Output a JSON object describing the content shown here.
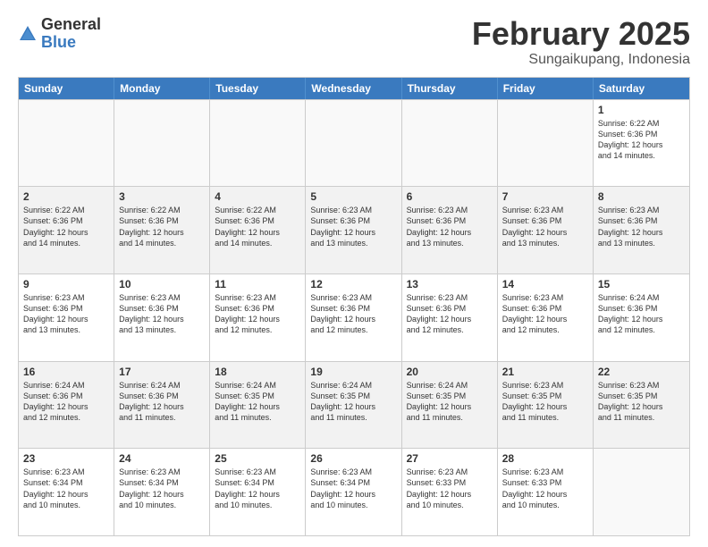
{
  "logo": {
    "general": "General",
    "blue": "Blue"
  },
  "title": "February 2025",
  "location": "Sungaikupang, Indonesia",
  "days_of_week": [
    "Sunday",
    "Monday",
    "Tuesday",
    "Wednesday",
    "Thursday",
    "Friday",
    "Saturday"
  ],
  "weeks": [
    [
      {
        "num": "",
        "info": ""
      },
      {
        "num": "",
        "info": ""
      },
      {
        "num": "",
        "info": ""
      },
      {
        "num": "",
        "info": ""
      },
      {
        "num": "",
        "info": ""
      },
      {
        "num": "",
        "info": ""
      },
      {
        "num": "1",
        "info": "Sunrise: 6:22 AM\nSunset: 6:36 PM\nDaylight: 12 hours\nand 14 minutes."
      }
    ],
    [
      {
        "num": "2",
        "info": "Sunrise: 6:22 AM\nSunset: 6:36 PM\nDaylight: 12 hours\nand 14 minutes."
      },
      {
        "num": "3",
        "info": "Sunrise: 6:22 AM\nSunset: 6:36 PM\nDaylight: 12 hours\nand 14 minutes."
      },
      {
        "num": "4",
        "info": "Sunrise: 6:22 AM\nSunset: 6:36 PM\nDaylight: 12 hours\nand 14 minutes."
      },
      {
        "num": "5",
        "info": "Sunrise: 6:23 AM\nSunset: 6:36 PM\nDaylight: 12 hours\nand 13 minutes."
      },
      {
        "num": "6",
        "info": "Sunrise: 6:23 AM\nSunset: 6:36 PM\nDaylight: 12 hours\nand 13 minutes."
      },
      {
        "num": "7",
        "info": "Sunrise: 6:23 AM\nSunset: 6:36 PM\nDaylight: 12 hours\nand 13 minutes."
      },
      {
        "num": "8",
        "info": "Sunrise: 6:23 AM\nSunset: 6:36 PM\nDaylight: 12 hours\nand 13 minutes."
      }
    ],
    [
      {
        "num": "9",
        "info": "Sunrise: 6:23 AM\nSunset: 6:36 PM\nDaylight: 12 hours\nand 13 minutes."
      },
      {
        "num": "10",
        "info": "Sunrise: 6:23 AM\nSunset: 6:36 PM\nDaylight: 12 hours\nand 13 minutes."
      },
      {
        "num": "11",
        "info": "Sunrise: 6:23 AM\nSunset: 6:36 PM\nDaylight: 12 hours\nand 12 minutes."
      },
      {
        "num": "12",
        "info": "Sunrise: 6:23 AM\nSunset: 6:36 PM\nDaylight: 12 hours\nand 12 minutes."
      },
      {
        "num": "13",
        "info": "Sunrise: 6:23 AM\nSunset: 6:36 PM\nDaylight: 12 hours\nand 12 minutes."
      },
      {
        "num": "14",
        "info": "Sunrise: 6:23 AM\nSunset: 6:36 PM\nDaylight: 12 hours\nand 12 minutes."
      },
      {
        "num": "15",
        "info": "Sunrise: 6:24 AM\nSunset: 6:36 PM\nDaylight: 12 hours\nand 12 minutes."
      }
    ],
    [
      {
        "num": "16",
        "info": "Sunrise: 6:24 AM\nSunset: 6:36 PM\nDaylight: 12 hours\nand 12 minutes."
      },
      {
        "num": "17",
        "info": "Sunrise: 6:24 AM\nSunset: 6:36 PM\nDaylight: 12 hours\nand 11 minutes."
      },
      {
        "num": "18",
        "info": "Sunrise: 6:24 AM\nSunset: 6:35 PM\nDaylight: 12 hours\nand 11 minutes."
      },
      {
        "num": "19",
        "info": "Sunrise: 6:24 AM\nSunset: 6:35 PM\nDaylight: 12 hours\nand 11 minutes."
      },
      {
        "num": "20",
        "info": "Sunrise: 6:24 AM\nSunset: 6:35 PM\nDaylight: 12 hours\nand 11 minutes."
      },
      {
        "num": "21",
        "info": "Sunrise: 6:23 AM\nSunset: 6:35 PM\nDaylight: 12 hours\nand 11 minutes."
      },
      {
        "num": "22",
        "info": "Sunrise: 6:23 AM\nSunset: 6:35 PM\nDaylight: 12 hours\nand 11 minutes."
      }
    ],
    [
      {
        "num": "23",
        "info": "Sunrise: 6:23 AM\nSunset: 6:34 PM\nDaylight: 12 hours\nand 10 minutes."
      },
      {
        "num": "24",
        "info": "Sunrise: 6:23 AM\nSunset: 6:34 PM\nDaylight: 12 hours\nand 10 minutes."
      },
      {
        "num": "25",
        "info": "Sunrise: 6:23 AM\nSunset: 6:34 PM\nDaylight: 12 hours\nand 10 minutes."
      },
      {
        "num": "26",
        "info": "Sunrise: 6:23 AM\nSunset: 6:34 PM\nDaylight: 12 hours\nand 10 minutes."
      },
      {
        "num": "27",
        "info": "Sunrise: 6:23 AM\nSunset: 6:33 PM\nDaylight: 12 hours\nand 10 minutes."
      },
      {
        "num": "28",
        "info": "Sunrise: 6:23 AM\nSunset: 6:33 PM\nDaylight: 12 hours\nand 10 minutes."
      },
      {
        "num": "",
        "info": ""
      }
    ]
  ]
}
